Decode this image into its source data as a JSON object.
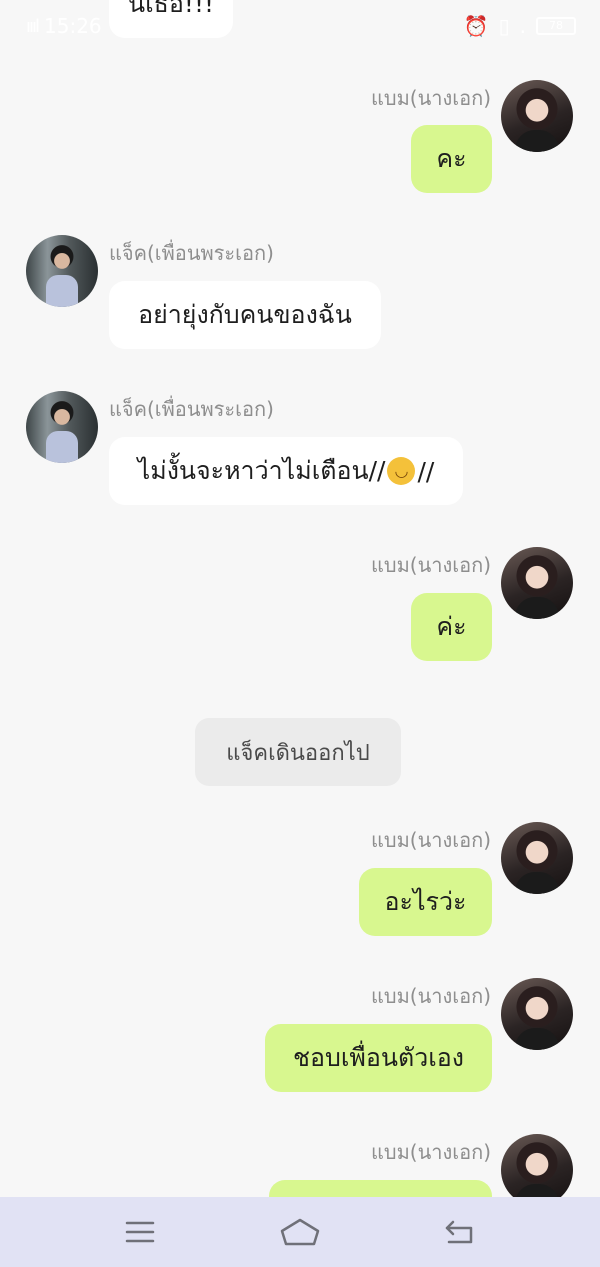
{
  "status_bar": {
    "time": "15:26",
    "signal": "ıııl",
    "alarm_icon": "⏰",
    "nosim_icon": "▯",
    "dot": ".",
    "battery": "78"
  },
  "messages": [
    {
      "text": "นเธอ!!!"
    },
    {
      "sender": "แบม(นางเอก)",
      "text": "คะ"
    },
    {
      "sender": "แจ็ค(เพื่อนพระเอก)",
      "text": "อย่ายุ่งกับคนของฉัน"
    },
    {
      "sender": "แจ็ค(เพื่อนพระเอก)",
      "text_before": "ไม่งั้นจะหาว่าไม่เตือน//",
      "emoji": "😏",
      "text_after": "//"
    },
    {
      "sender": "แบม(นางเอก)",
      "text": "ค่ะ"
    },
    {
      "sender": "แบม(นางเอก)",
      "text": "อะไรว่ะ"
    },
    {
      "sender": "แบม(นางเอก)",
      "text": "ชอบเพื่อนตัวเอง"
    },
    {
      "sender": "แบม(นางเอก)",
      "text": ""
    }
  ],
  "system_message": "แจ็คเดินออกไป",
  "colors": {
    "my_bubble": "#d8f78f",
    "their_bubble": "#ffffff",
    "background": "#f7f7f7",
    "navbar": "#e1e2f4"
  },
  "navbar": {
    "icons": [
      "menu-icon",
      "home-icon",
      "back-icon"
    ]
  }
}
